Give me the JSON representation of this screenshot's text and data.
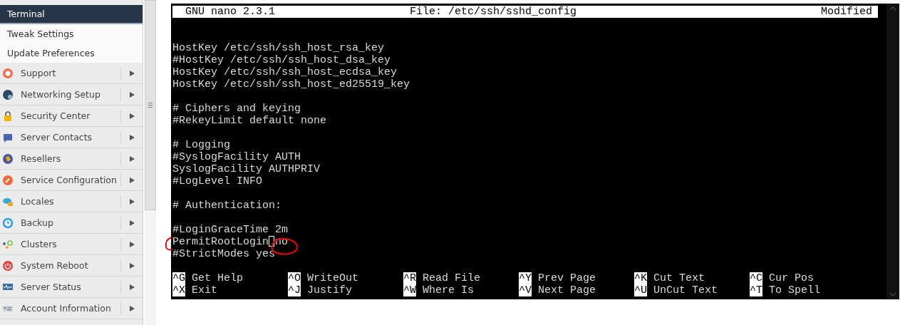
{
  "sidebar": {
    "subitems": [
      {
        "label": "Terminal",
        "selected": true
      },
      {
        "label": "Tweak Settings",
        "selected": false
      },
      {
        "label": "Update Preferences",
        "selected": false
      }
    ],
    "categories": [
      {
        "label": "Support"
      },
      {
        "label": "Networking Setup"
      },
      {
        "label": "Security Center"
      },
      {
        "label": "Server Contacts"
      },
      {
        "label": "Resellers"
      },
      {
        "label": "Service Configuration"
      },
      {
        "label": "Locales"
      },
      {
        "label": "Backup"
      },
      {
        "label": "Clusters"
      },
      {
        "label": "System Reboot"
      },
      {
        "label": "Server Status"
      },
      {
        "label": "Account Information"
      }
    ]
  },
  "terminal": {
    "header": {
      "program": "GNU nano 2.3.1",
      "file": "File: /etc/ssh/sshd_config",
      "status": "Modified"
    },
    "lines": [
      {
        "text": "HostKey /etc/ssh/ssh_host_rsa_key"
      },
      {
        "text": "#HostKey /etc/ssh/ssh_host_dsa_key"
      },
      {
        "text": "HostKey /etc/ssh/ssh_host_ecdsa_key"
      },
      {
        "text": "HostKey /etc/ssh/ssh_host_ed25519_key"
      },
      {
        "text": "# Ciphers and keying",
        "gap_before": true
      },
      {
        "text": "#RekeyLimit default none"
      },
      {
        "text": "# Logging",
        "gap_before": true
      },
      {
        "text": "#SyslogFacility AUTH"
      },
      {
        "text": "SyslogFacility AUTHPRIV"
      },
      {
        "text": "#LogLevel INFO"
      },
      {
        "text": "# Authentication:",
        "gap_before": true
      },
      {
        "text": "#LoginGraceTime 2m",
        "gap_before": true
      },
      {
        "text": "PermitRootLogin",
        "cursor": true,
        "rest": "no"
      },
      {
        "text": "#StrictModes yes"
      }
    ],
    "shortcuts": [
      [
        {
          "key": "^G",
          "label": "Get Help"
        },
        {
          "key": "^O",
          "label": "WriteOut"
        },
        {
          "key": "^R",
          "label": "Read File"
        },
        {
          "key": "^Y",
          "label": "Prev Page"
        },
        {
          "key": "^K",
          "label": "Cut Text"
        },
        {
          "key": "^C",
          "label": "Cur Pos"
        }
      ],
      [
        {
          "key": "^X",
          "label": "Exit"
        },
        {
          "key": "^J",
          "label": "Justify"
        },
        {
          "key": "^W",
          "label": "Where Is"
        },
        {
          "key": "^V",
          "label": "Next Page"
        },
        {
          "key": "^U",
          "label": "UnCut Text"
        },
        {
          "key": "^T",
          "label": "To Spell"
        }
      ]
    ]
  }
}
